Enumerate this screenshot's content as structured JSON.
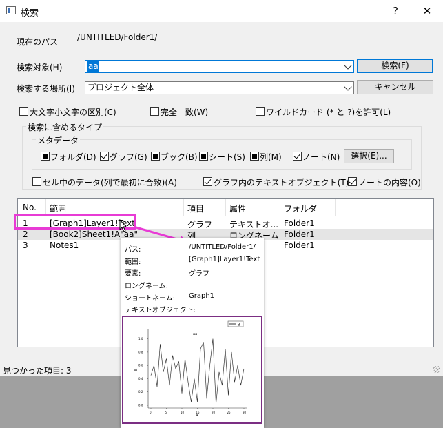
{
  "window": {
    "title": "検索",
    "help_label": "?",
    "close_label": "✕"
  },
  "path": {
    "label": "現在のパス",
    "value": "/UNTITLED/Folder1/"
  },
  "search_target": {
    "label": "検索対象(H)",
    "value": "aa"
  },
  "search_location": {
    "label": "検索する場所(I)",
    "value": "プロジェクト全体"
  },
  "buttons": {
    "search": "検索(F)",
    "cancel": "キャンセル",
    "select": "選択(E)..."
  },
  "options": {
    "case_sensitive": "大文字小文字の区別(C)",
    "whole_word": "完全一致(W)",
    "wildcard": "ワイルドカード (* と ?)を許可(L)"
  },
  "types_group": {
    "title": "検索に含めるタイプ",
    "metadata_title": "メタデータ",
    "items": [
      "フォルダ(D)",
      "グラフ(G)",
      "ブック(B)",
      "シート(S)",
      "列(M)",
      "ノート(N)"
    ],
    "cell_data": "セル中のデータ(列で最初に合致)(A)",
    "graph_text": "グラフ内のテキストオブジェクト(T)",
    "note_content": "ノートの内容(O)"
  },
  "results": {
    "columns": [
      "No.",
      "範囲",
      "項目",
      "属性",
      "フォルダ"
    ],
    "rows": [
      [
        "1",
        "[Graph1]Layer1!Text",
        "グラフ",
        "テキストオ...",
        "Folder1"
      ],
      [
        "2",
        "[Book2]Sheet1!A\"aa\"",
        "列",
        "ロングネーム",
        "Folder1"
      ],
      [
        "3",
        "Notes1",
        "",
        "",
        "Folder1"
      ]
    ]
  },
  "status": {
    "text": "見つかった項目: 3"
  },
  "tooltip": {
    "rows": [
      {
        "label": "パス:",
        "value": "/UNTITLED/Folder1/"
      },
      {
        "label": "範囲:",
        "value": "[Graph1]Layer1!Text"
      },
      {
        "label": "要素:",
        "value": "グラフ"
      },
      {
        "label": "ロングネーム:",
        "value": ""
      },
      {
        "label": "ショートネーム:",
        "value": "Graph1"
      },
      {
        "label": "テキストオブジェクト:",
        "value": ""
      }
    ]
  },
  "preview": {
    "annotation": "aa",
    "legend": "B",
    "xlabel": "A",
    "ylabel": "B",
    "y_ticks": [
      "0.0",
      "0.2",
      "0.4",
      "0.6",
      "0.8",
      "1.0"
    ],
    "x_ticks": [
      "0",
      "5",
      "10",
      "15",
      "20",
      "25",
      "30"
    ]
  },
  "colors": {
    "accent": "#0078d7",
    "highlight": "#e83bd5",
    "preview_border": "#7b2e83"
  },
  "chart_data": {
    "type": "line",
    "title": "aa",
    "xlabel": "A",
    "ylabel": "B",
    "xlim": [
      0,
      30
    ],
    "ylim": [
      0,
      1.1
    ],
    "series": [
      {
        "name": "B",
        "x": [
          0,
          1,
          2,
          3,
          4,
          5,
          6,
          7,
          8,
          9,
          10,
          11,
          12,
          13,
          14,
          15,
          16,
          17,
          18,
          19,
          20,
          21,
          22,
          23,
          24,
          25,
          26,
          27,
          28,
          29,
          30
        ],
        "values": [
          0.45,
          0.6,
          0.28,
          0.92,
          0.5,
          0.7,
          0.3,
          0.75,
          0.55,
          0.66,
          0.18,
          0.7,
          0.35,
          0.05,
          0.4,
          0.05,
          0.85,
          0.95,
          0.1,
          0.6,
          1.0,
          0.02,
          0.5,
          0.3,
          0.85,
          0.15,
          0.8,
          0.35,
          0.6,
          0.3,
          0.55
        ]
      }
    ]
  }
}
